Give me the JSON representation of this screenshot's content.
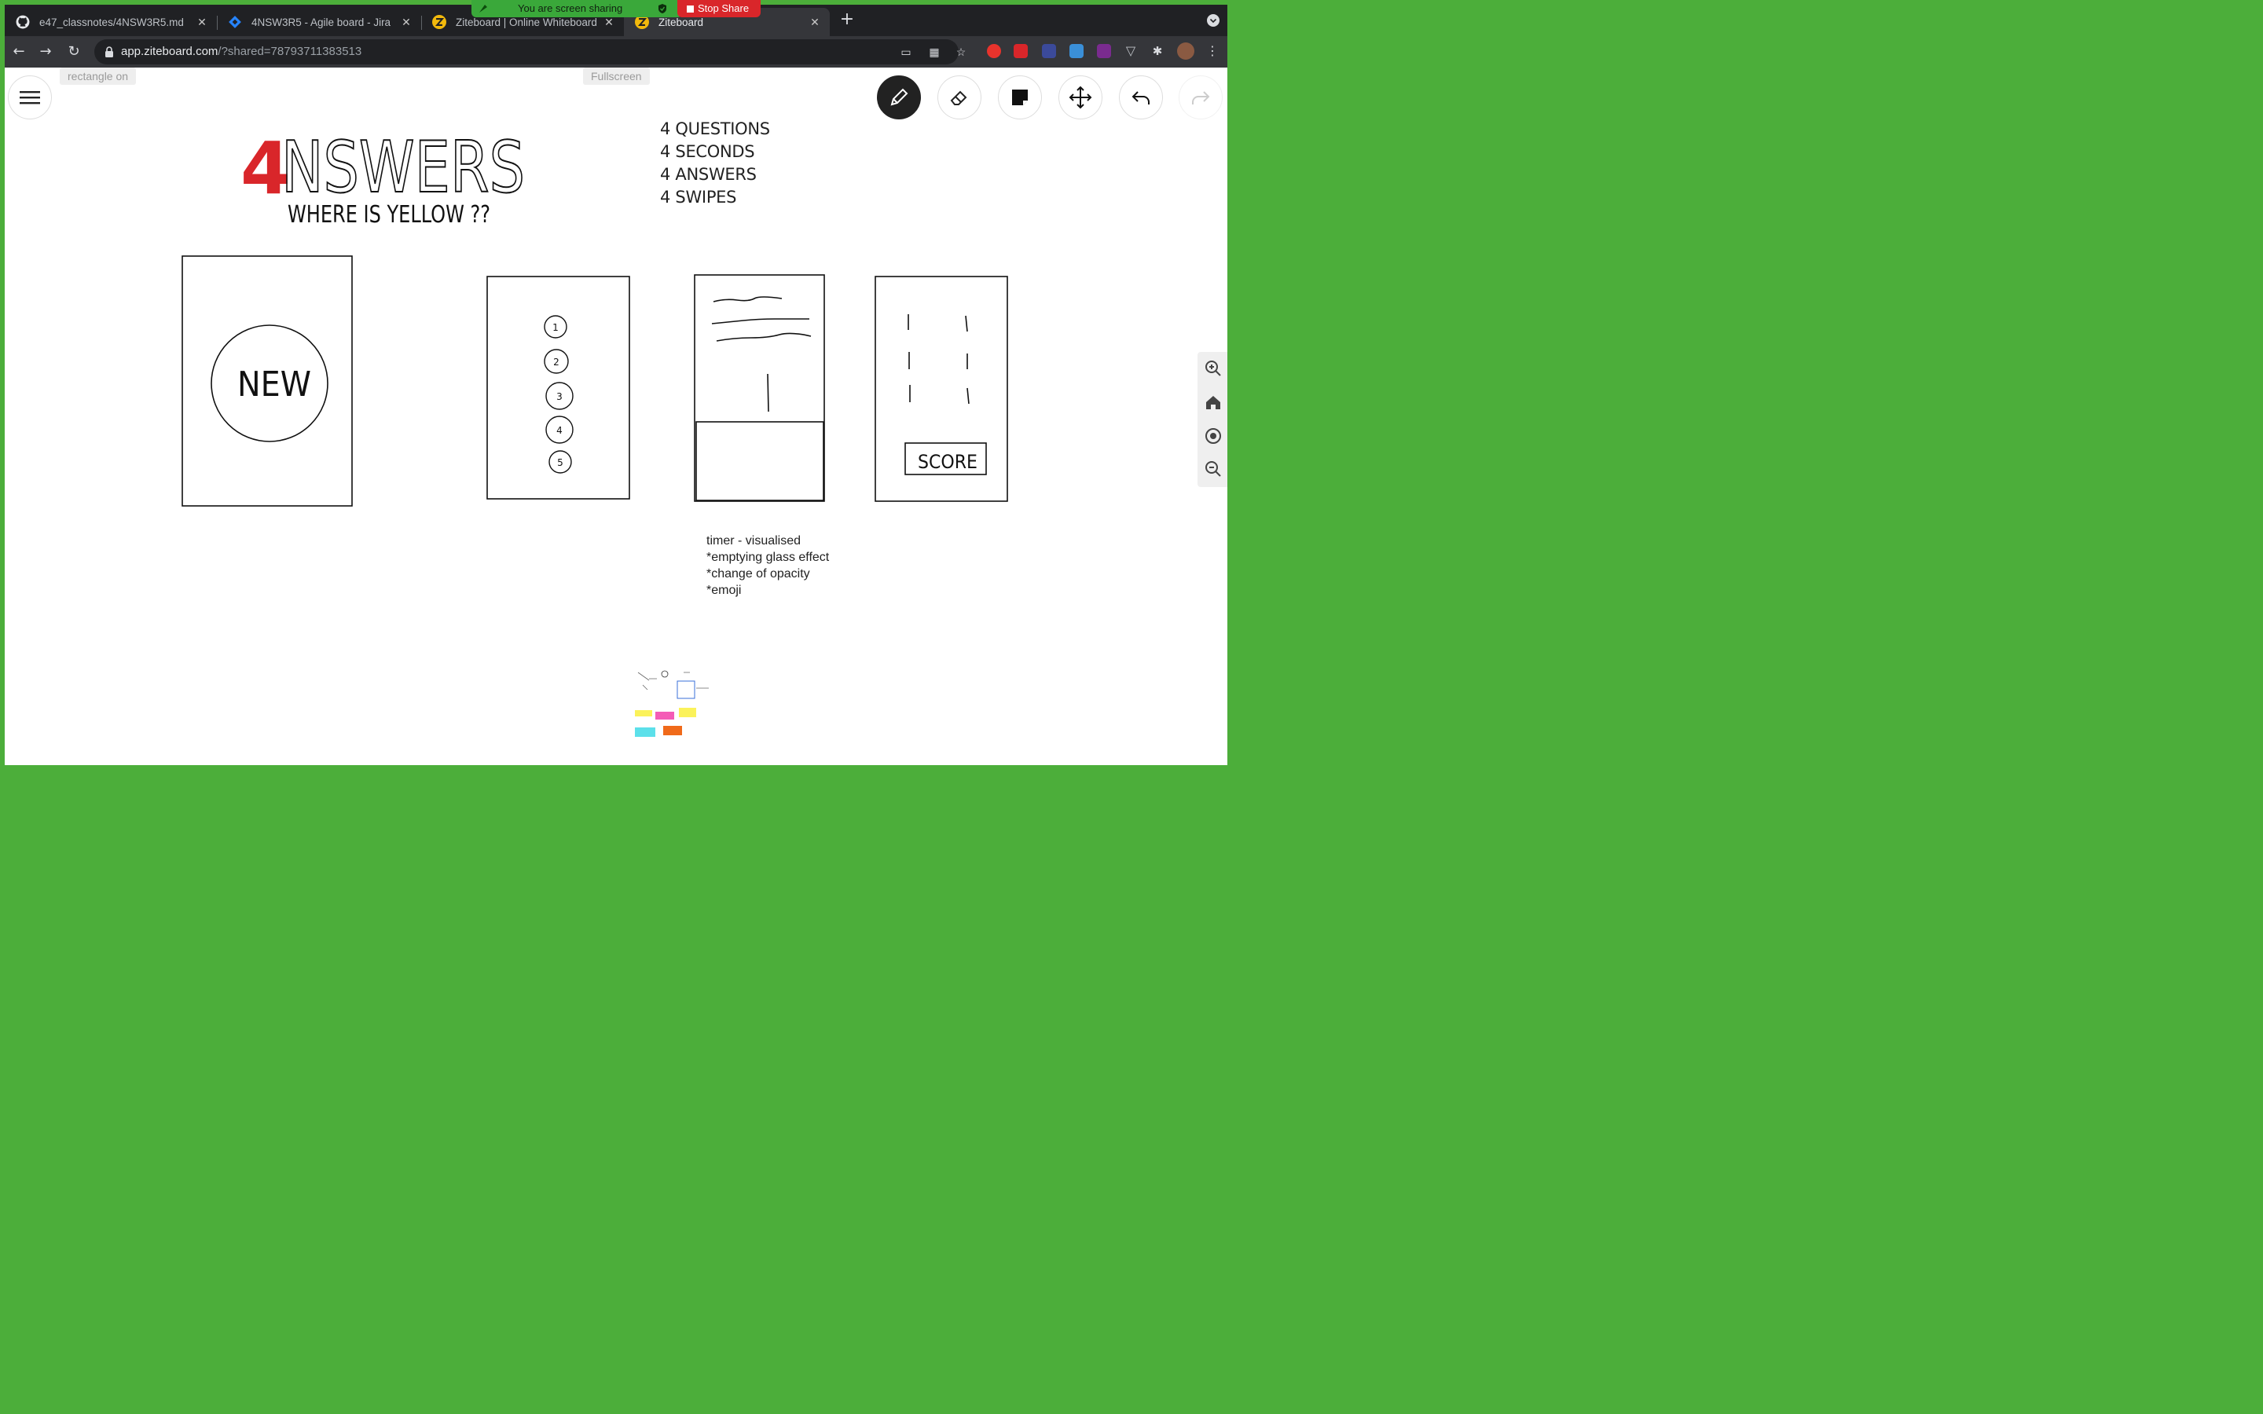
{
  "share_banner": {
    "text": "You are screen sharing",
    "stop_label": "Stop Share"
  },
  "tabs": [
    {
      "title": "e47_classnotes/4NSW3R5.md",
      "icon": "github-icon"
    },
    {
      "title": "4NSW3R5 - Agile board - Jira",
      "icon": "jira-icon"
    },
    {
      "title": "Ziteboard | Online Whiteboard",
      "icon": "ziteboard-icon"
    },
    {
      "title": "Ziteboard",
      "icon": "ziteboard-icon",
      "active": true
    }
  ],
  "address": {
    "host": "app.ziteboard.com",
    "path": "/?shared=78793711383513"
  },
  "board": {
    "hint_left": "rectangle on",
    "hint_center": "Fullscreen",
    "tools": [
      "pencil-icon",
      "eraser-icon",
      "sticky-note-icon",
      "move-icon",
      "undo-icon",
      "redo-icon"
    ],
    "zoom_controls": [
      "zoom-in-icon",
      "home-icon",
      "center-icon",
      "zoom-out-icon"
    ],
    "title_first": "4",
    "title_rest": "NSWERS",
    "subtitle": "WHERE IS YELLOW ??",
    "question_lines": [
      "4 QUESTIONS",
      "4 SECONDS",
      "4 ANSWERS",
      "4 SWIPES"
    ],
    "screen_new_label": "NEW",
    "screen_digits": [
      "1",
      "2",
      "3",
      "4",
      "5"
    ],
    "screen_score_label": "SCORE",
    "timer_notes": [
      "timer - visualised",
      "*emptying glass effect",
      "*change of opacity",
      "*emoji"
    ]
  },
  "colors": {
    "accent_red": "#d9262a",
    "share_green": "#3aa83a",
    "chrome_dark": "#202124"
  }
}
